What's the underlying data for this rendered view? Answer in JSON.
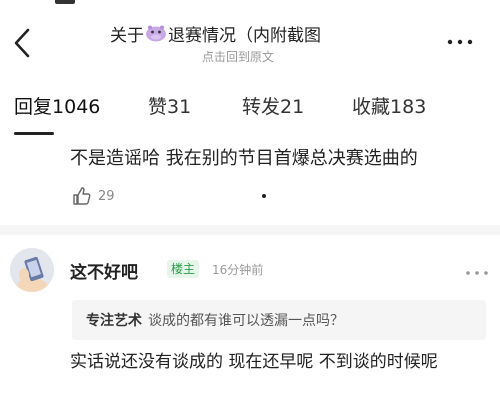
{
  "header": {
    "title_prefix": "关于",
    "title_suffix": "退赛情况（内附截图",
    "subtitle": "点击回到原文",
    "back_icon": "chevron-left-icon",
    "more_icon": "more-dots-icon"
  },
  "tabs": [
    {
      "label": "回复",
      "count": "1046",
      "active": true
    },
    {
      "label": "赞",
      "count": "31",
      "active": false
    },
    {
      "label": "转发",
      "count": "21",
      "active": false
    },
    {
      "label": "收藏",
      "count": "183",
      "active": false
    }
  ],
  "comment_1": {
    "text": "不是造谣哈 我在别的节目首爆总决赛选曲的",
    "likes": "29"
  },
  "comment_2": {
    "username": "这不好吧",
    "badge": "楼主",
    "time": "16分钟前",
    "quote_user": "专注艺术",
    "quote_text": "谈成的都有谁可以透漏一点吗？",
    "reply": "实话说还没有谈成的 现在还早呢 不到谈的时候呢"
  },
  "colors": {
    "badge_bg": "#e6f6ea",
    "badge_text": "#2a9d4a",
    "quote_bg": "#f5f5f5"
  }
}
